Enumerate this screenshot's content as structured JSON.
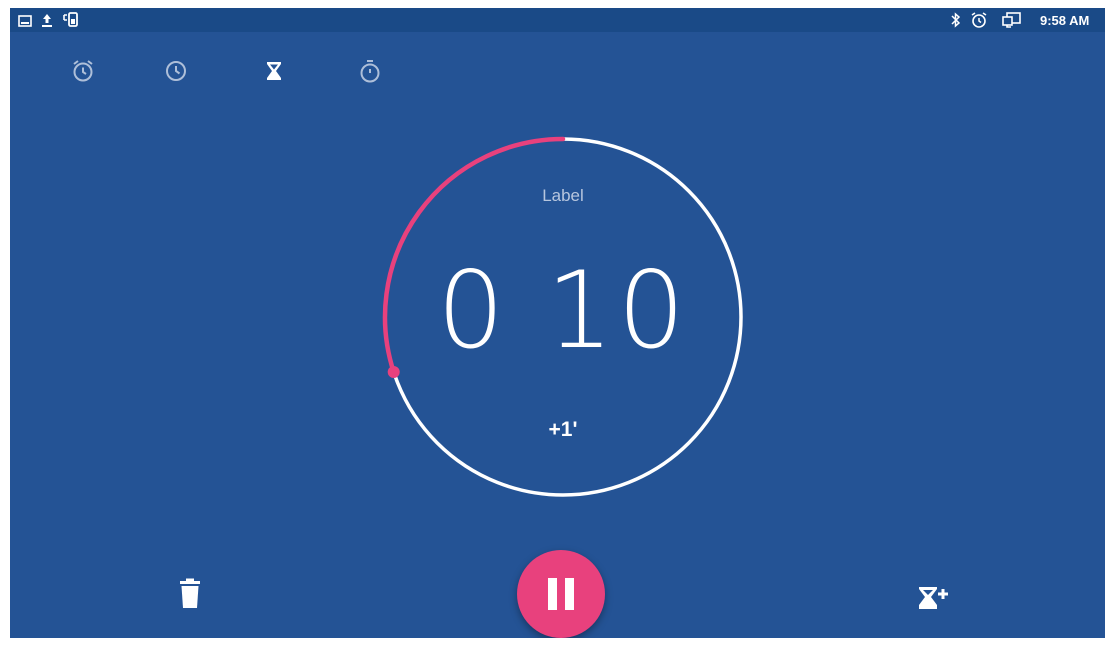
{
  "status_bar": {
    "left_icons": [
      "image-icon",
      "upload-icon",
      "phone-transfer-icon"
    ],
    "right_icons": [
      "bluetooth-icon",
      "alarm-icon",
      "cast-icon"
    ],
    "clock": "9:58 AM"
  },
  "tabs": [
    {
      "name": "alarm",
      "icon": "alarm-clock-icon",
      "selected": false
    },
    {
      "name": "clock",
      "icon": "clock-icon",
      "selected": false
    },
    {
      "name": "timer",
      "icon": "hourglass-icon",
      "selected": true
    },
    {
      "name": "stopwatch",
      "icon": "stopwatch-icon",
      "selected": false
    }
  ],
  "timer": {
    "label": "Label",
    "time": "0 10",
    "add_minute": "+1'",
    "progress": 0.3
  },
  "actions": {
    "delete_icon": "trash-icon",
    "pause_icon": "pause-icon",
    "add_timer_icon": "add-timer-icon"
  },
  "colors": {
    "background": "#245395",
    "status_bar": "#1a4a87",
    "accent": "#e8417d",
    "ring": "#ffffff"
  }
}
